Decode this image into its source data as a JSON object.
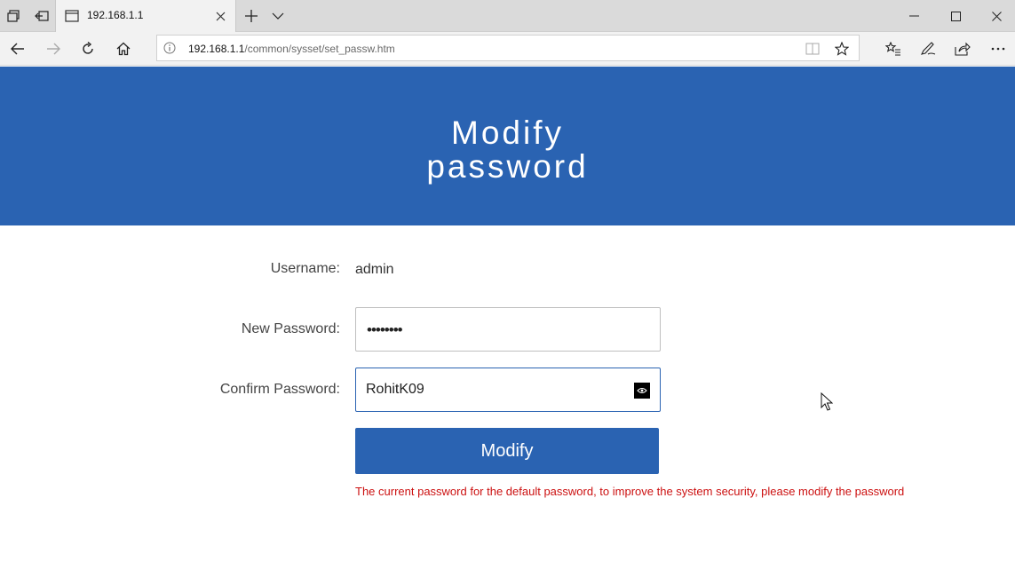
{
  "browser": {
    "tab": {
      "title": "192.168.1.1"
    },
    "address": {
      "host": "192.168.1.1",
      "path": "/common/sysset/set_passw.htm"
    }
  },
  "page": {
    "title_line1": "Modify",
    "title_line2": "password",
    "username_label": "Username:",
    "username_value": "admin",
    "new_password_label": "New Password:",
    "new_password_masked": "••••••••",
    "confirm_password_label": "Confirm Password:",
    "confirm_password_value": "RohitK09",
    "modify_button": "Modify",
    "warning": "The current password for the default password, to improve the system security, please modify the password"
  },
  "colors": {
    "banner": "#2a63b2",
    "button": "#2a63b2",
    "warning_text": "#cc1111"
  }
}
